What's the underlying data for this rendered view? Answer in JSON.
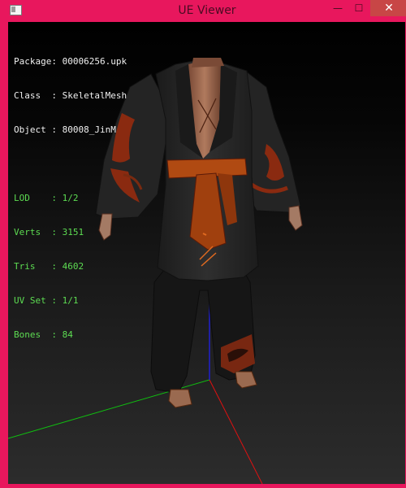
{
  "window": {
    "title": "UE Viewer",
    "controls": {
      "minimize": "—",
      "maximize": "☐",
      "close": "✕"
    }
  },
  "info": {
    "package": {
      "label": "Package:",
      "value": "00006256.upk"
    },
    "class": {
      "label": "Class  :",
      "value": "SkeletalMesh"
    },
    "object": {
      "label": "Object :",
      "value": "80008_JinM"
    },
    "lod": {
      "label": "LOD    :",
      "value": "1/2"
    },
    "verts": {
      "label": "Verts  :",
      "value": "3151"
    },
    "tris": {
      "label": "Tris   :",
      "value": "4602"
    },
    "uvset": {
      "label": "UV Set :",
      "value": "1/1"
    },
    "bones": {
      "label": "Bones  :",
      "value": "84"
    }
  },
  "colors": {
    "window_frame": "#e8175d",
    "close_button": "#c84646",
    "info_text": "#f0f0f0",
    "stats_text": "#5ddc52",
    "axis_x": "#e01010",
    "axis_y": "#10c010",
    "axis_z": "#2020d0"
  }
}
